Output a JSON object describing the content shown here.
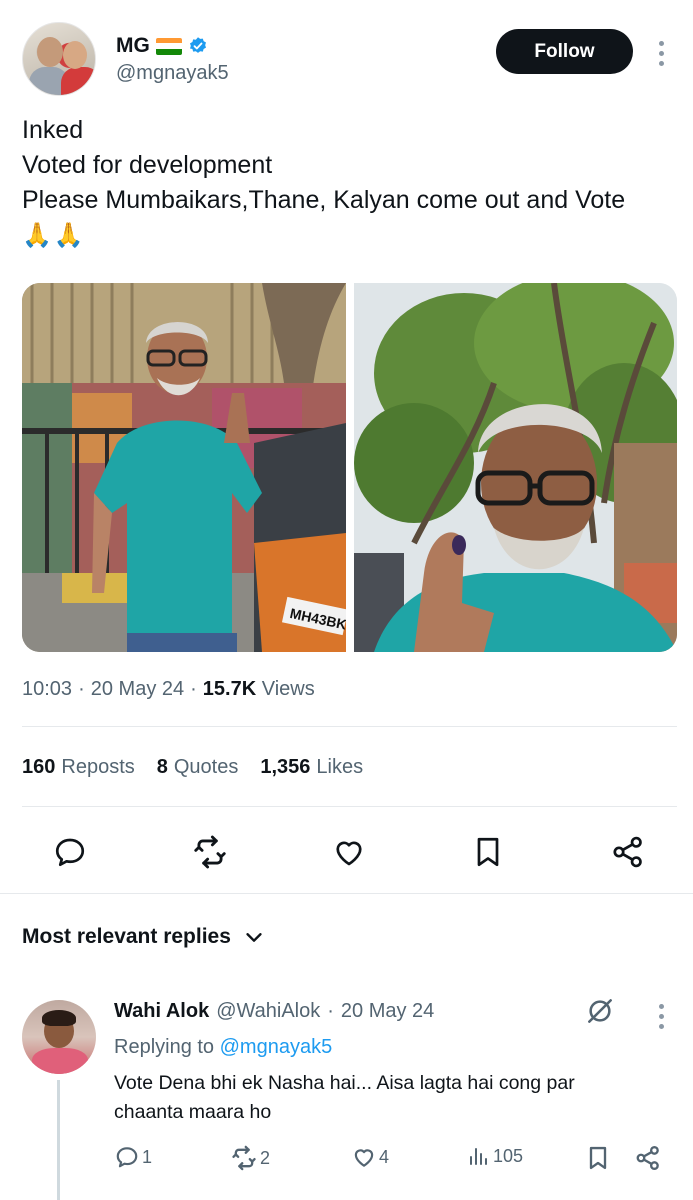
{
  "tweet": {
    "author": {
      "display_name": "MG",
      "handle": "@mgnayak5",
      "flag_icon": "india-flag-icon",
      "verified_icon": "verified-badge-icon"
    },
    "follow_label": "Follow",
    "text_lines": [
      "Inked",
      "Voted for development",
      "Please Mumbaikars,Thane, Kalyan come out and Vote"
    ],
    "emoji_line": "🙏🙏",
    "photos": [
      {
        "plate_text": "MH43BK"
      },
      {
        "plate_text": ""
      }
    ],
    "meta": {
      "time": "10:03",
      "date": "20 May 24",
      "views_count": "15.7K",
      "views_label": "Views"
    },
    "stats": {
      "reposts_count": "160",
      "reposts_label": "Reposts",
      "quotes_count": "8",
      "quotes_label": "Quotes",
      "likes_count": "1,356",
      "likes_label": "Likes"
    },
    "actions": [
      "reply-icon",
      "retweet-icon",
      "like-icon",
      "bookmark-icon",
      "share-icon"
    ]
  },
  "replies_section": {
    "label": "Most relevant replies",
    "chevron_icon": "chevron-down-icon"
  },
  "reply": {
    "display_name": "Wahi Alok",
    "handle": "@WahiAlok",
    "date": "20 May 24",
    "replying_to_label": "Replying to",
    "replying_to_handle": "@mgnayak5",
    "text": "Vote Dena bhi ek Nasha hai... Aisa lagta hai cong par chaanta maara ho",
    "reply_count": "1",
    "retweet_count": "2",
    "like_count": "4",
    "view_count": "105"
  },
  "colors": {
    "text_primary": "#0f1419",
    "text_secondary": "#536471",
    "accent": "#1d9bf0",
    "follow_bg": "#0f1419"
  }
}
